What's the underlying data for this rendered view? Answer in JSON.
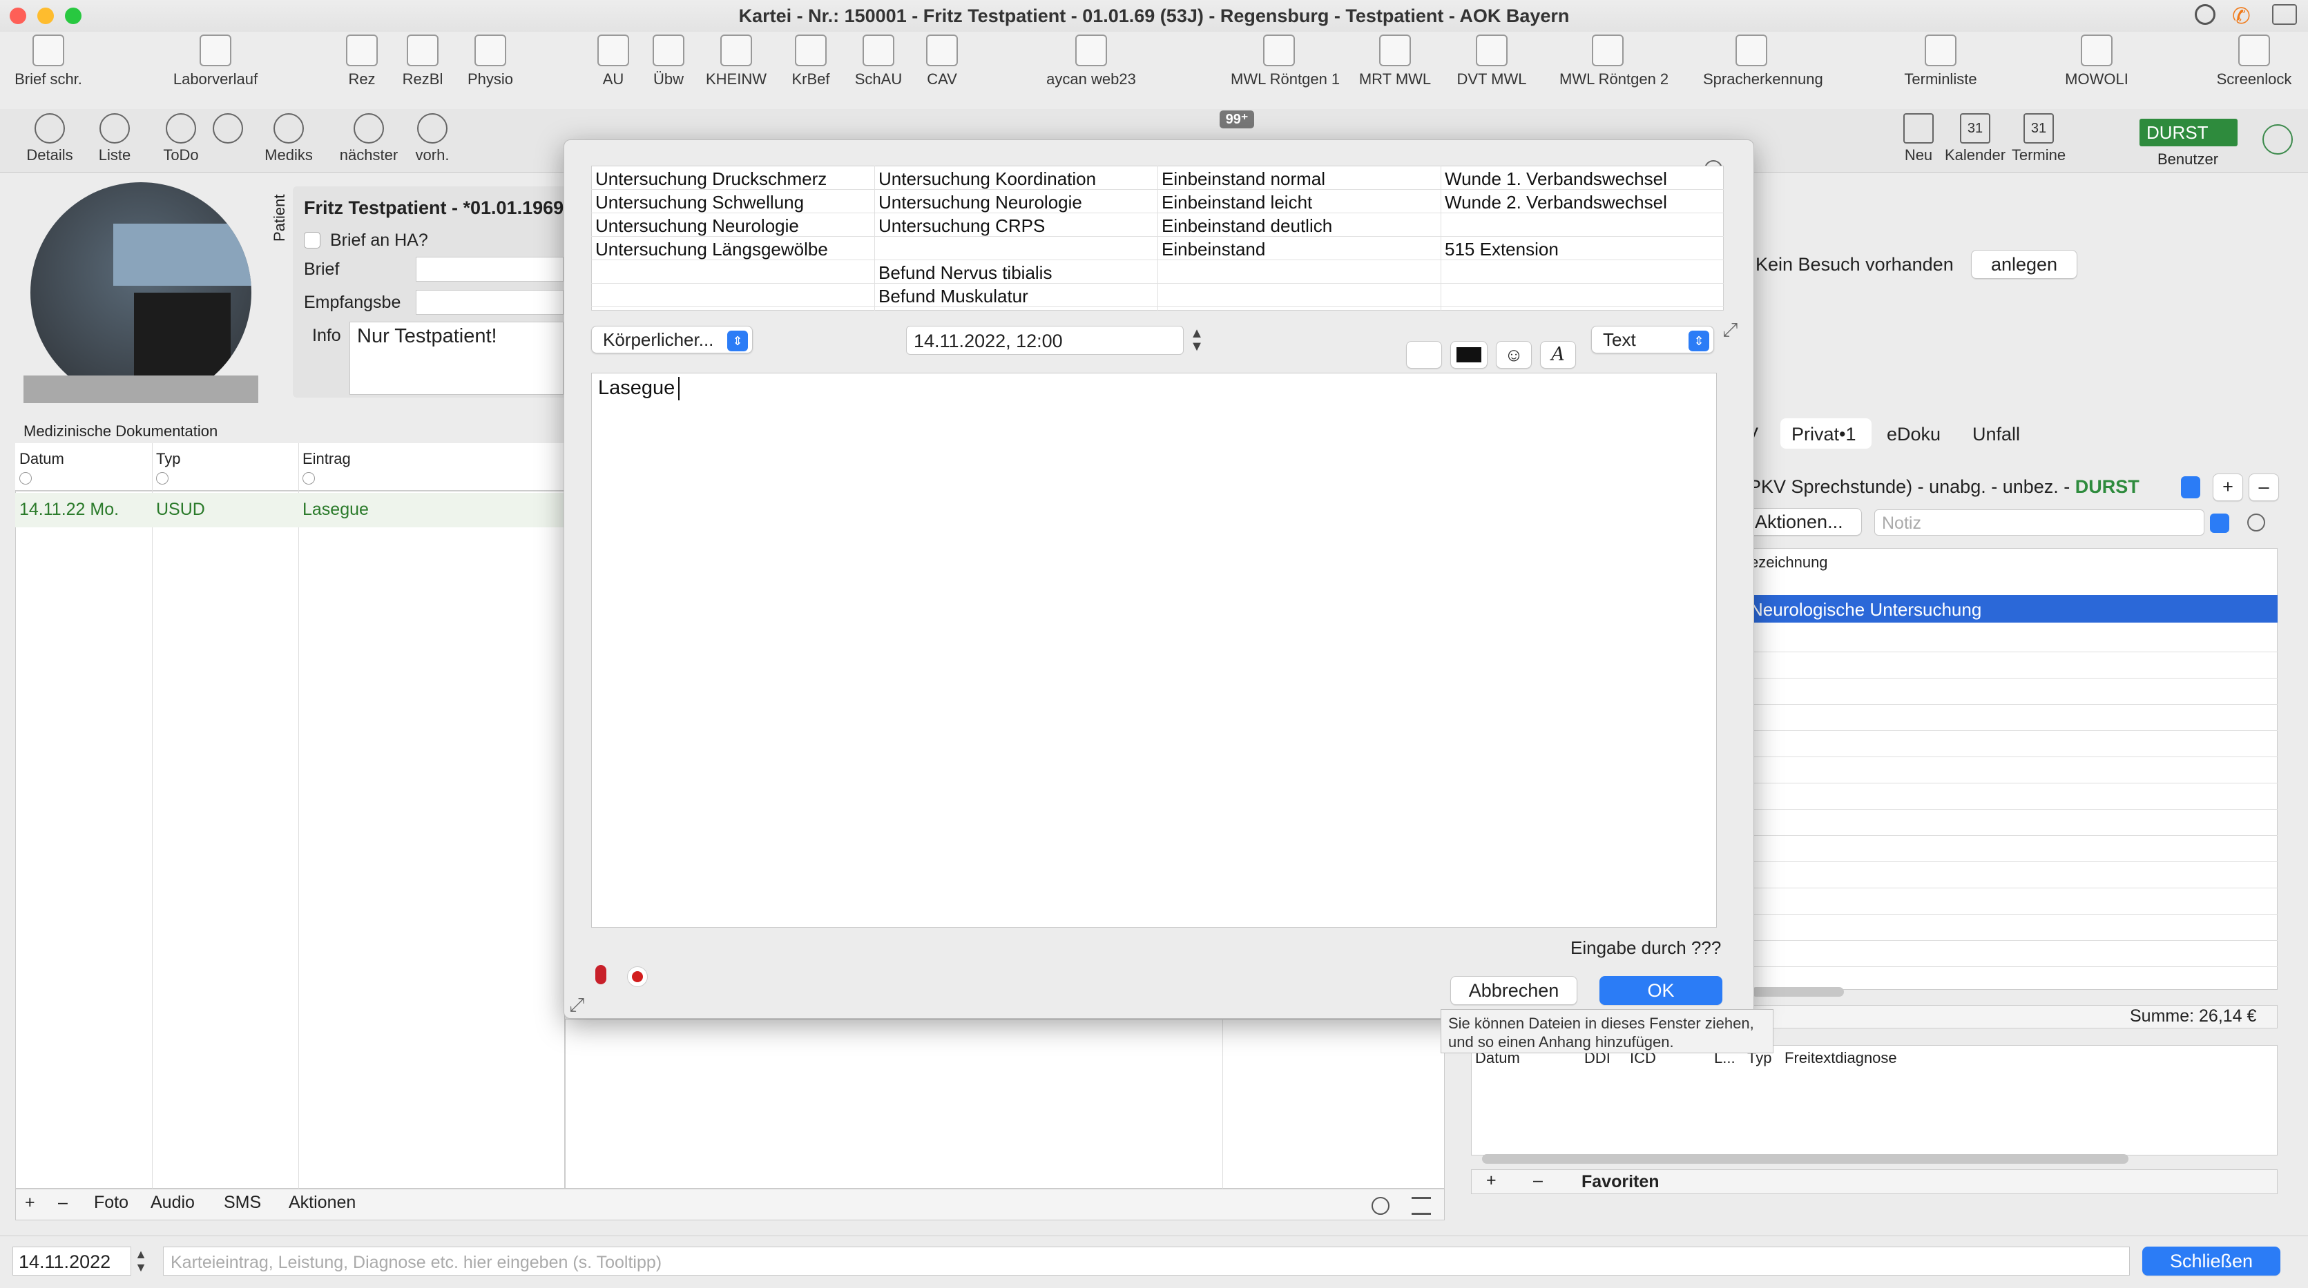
{
  "window": {
    "title": "Kartei - Nr.: 150001 - Fritz Testpatient - 01.01.69 (53J) - Regensburg - Testpatient - AOK Bayern"
  },
  "toolbar": {
    "items": [
      {
        "label": "Brief schr.",
        "icon": "letter-icon"
      },
      {
        "label": "Laborverlauf",
        "icon": "lab-flask-icon"
      },
      {
        "label": "Rez",
        "icon": "prescription-icon"
      },
      {
        "label": "RezBl",
        "icon": "prescription-blue-icon"
      },
      {
        "label": "Physio",
        "icon": "physio-doc-icon"
      },
      {
        "label": "AU",
        "icon": "au-doc-icon"
      },
      {
        "label": "Übw",
        "icon": "referral-icon"
      },
      {
        "label": "KHEINW",
        "icon": "hospital-icon"
      },
      {
        "label": "KrBef",
        "icon": "ambulance-icon"
      },
      {
        "label": "SchAU",
        "icon": "school-au-icon"
      },
      {
        "label": "CAV",
        "icon": "clipboard-add-icon"
      },
      {
        "label": "aycan web23",
        "icon": "aycan-icon"
      },
      {
        "label": "MWL Röntgen 1",
        "icon": "xray-icon"
      },
      {
        "label": "MRT MWL",
        "icon": "mrt-icon"
      },
      {
        "label": "DVT MWL",
        "icon": "dvt-icon"
      },
      {
        "label": "MWL Röntgen 2",
        "icon": "xray2-icon"
      },
      {
        "label": "Spracherkennung",
        "icon": "microphone-icon"
      },
      {
        "label": "Terminliste",
        "icon": "calendar-list-icon"
      },
      {
        "label": "MOWOLI",
        "icon": "mowoli-icon"
      },
      {
        "label": "Screenlock",
        "icon": "screenlock-icon"
      }
    ]
  },
  "toolbar2": {
    "items": [
      {
        "label": "Details",
        "icon": "person-icon"
      },
      {
        "label": "Liste",
        "icon": "person-add-icon"
      },
      {
        "label": "ToDo",
        "icon": "back-icon"
      },
      {
        "label": "",
        "icon": "check-icon"
      },
      {
        "label": "Mediks",
        "icon": "pills-icon"
      },
      {
        "label": "nächster",
        "icon": "next-icon"
      },
      {
        "label": "vorh.",
        "icon": "prev-icon"
      }
    ],
    "badge": "99⁺",
    "right_items": [
      {
        "label": "Neu",
        "icon": "calendar-add-icon"
      },
      {
        "label": "Kalender",
        "icon": "calendar-31-icon",
        "day": "31"
      },
      {
        "label": "Termine",
        "icon": "termine-icon",
        "day": "31"
      }
    ],
    "user": {
      "name": "DURST",
      "caption": "Benutzer",
      "color": "#2e8b3d"
    }
  },
  "patient": {
    "vertical_label": "Patient",
    "name": "Fritz Testpatient - *01.01.1969",
    "brief_ha": "Brief an HA?",
    "brief_label": "Brief",
    "empfangsbe_label": "Empfangsbe",
    "info_label": "Info",
    "info_value": "Nur Testpatient!"
  },
  "visit": {
    "text": "Kein Besuch vorhanden",
    "button": "anlegen"
  },
  "doku": {
    "title": "Medizinische Dokumentation",
    "columns": [
      "Datum",
      "Typ",
      "Eintrag"
    ],
    "rows": [
      {
        "datum": "14.11.22  Mo.",
        "typ": "USUD",
        "eintrag": "Lasegue"
      }
    ]
  },
  "bottom_tabs": [
    "+",
    "–",
    "Foto",
    "Audio",
    "SMS",
    "Aktionen"
  ],
  "right": {
    "tabs": [
      "V",
      "Privat•1",
      "eDoku",
      "Unfall"
    ],
    "selector": "PKV Sprechstunde) - unabg. - unbez. - ",
    "selector_user": "DURST",
    "aktionen": "Aktionen...",
    "notiz_placeholder": "Notiz",
    "column": "ezeichnung",
    "selected_row": "Neurologische Untersuchung",
    "sum_label": "en",
    "sum": "Summe: 26,14 €",
    "diag_columns": [
      "Datum",
      "DDI",
      "ICD",
      "L...",
      "Typ",
      "Freitextdiagnose"
    ],
    "diag_tabs": [
      "+",
      "–",
      "Favoriten"
    ]
  },
  "dialog": {
    "grid": [
      [
        "Untersuchung Druckschmerz",
        "Untersuchung Koordination",
        "Einbeinstand normal",
        "Wunde 1. Verbandswechsel"
      ],
      [
        "Untersuchung Schwellung",
        "Untersuchung Neurologie",
        "Einbeinstand leicht",
        "Wunde 2. Verbandswechsel"
      ],
      [
        "Untersuchung Neurologie",
        "Untersuchung CRPS",
        "Einbeinstand deutlich",
        ""
      ],
      [
        "Untersuchung Längsgewölbe",
        "",
        "Einbeinstand",
        "515 Extension"
      ],
      [
        "",
        "Befund Nervus tibialis",
        "",
        ""
      ],
      [
        "",
        "Befund Muskulatur",
        "",
        ""
      ]
    ],
    "category": "Körperlicher...",
    "datetime": "14.11.2022, 12:00",
    "format": "Text",
    "content": "Lasegue",
    "eingabe": "Eingabe durch ???",
    "cancel": "Abbrechen",
    "ok": "OK"
  },
  "tooltip": "Sie können Dateien in dieses Fenster ziehen, und so einen Anhang hinzufügen.",
  "bottombar": {
    "date": "14.11.2022",
    "placeholder": "Karteieintrag, Leistung, Diagnose etc. hier eingeben (s. Tooltipp)",
    "close": "Schließen"
  }
}
